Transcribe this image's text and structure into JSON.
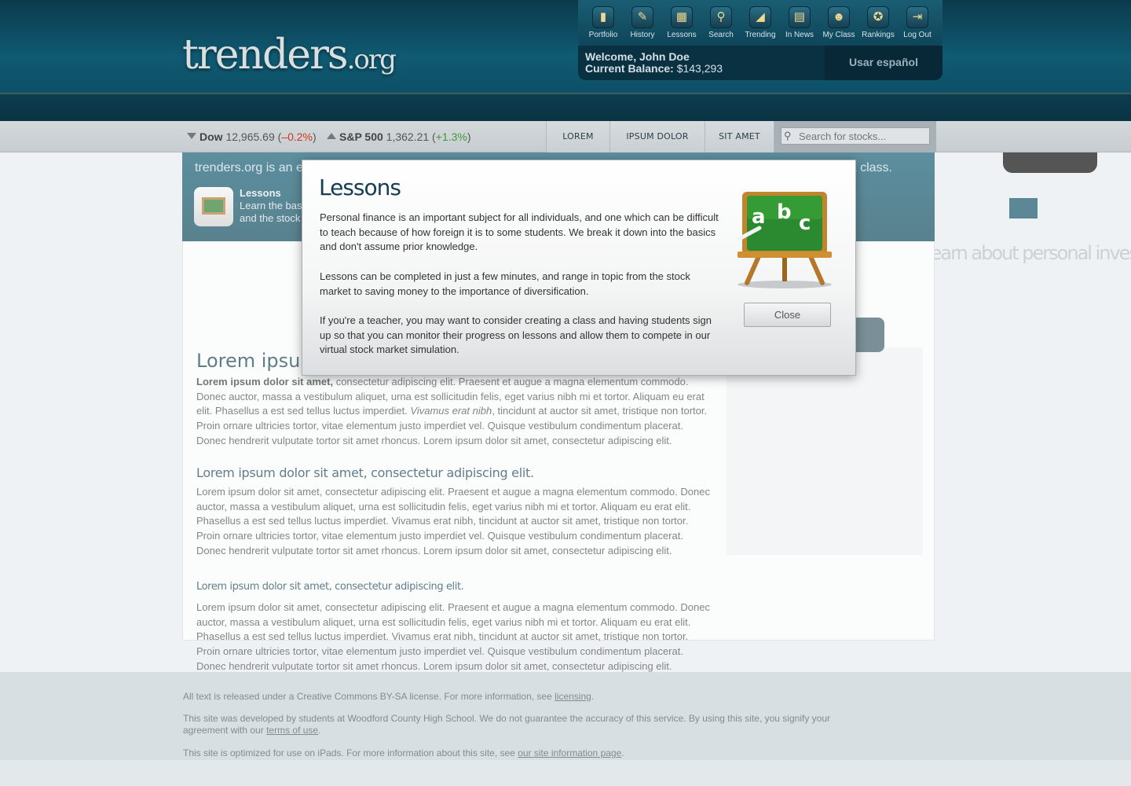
{
  "header": {
    "logo_main": "trenders",
    "logo_suffix": ".org",
    "nav": [
      {
        "label": "Portfolio",
        "icon": "portfolio-icon",
        "glyph": "▮"
      },
      {
        "label": "History",
        "icon": "history-icon",
        "glyph": "✎"
      },
      {
        "label": "Lessons",
        "icon": "lessons-icon",
        "glyph": "▦"
      },
      {
        "label": "Search",
        "icon": "search-icon",
        "glyph": "⚲"
      },
      {
        "label": "Trending",
        "icon": "trending-icon",
        "glyph": "◢"
      },
      {
        "label": "In News",
        "icon": "news-icon",
        "glyph": "▤"
      },
      {
        "label": "My Class",
        "icon": "class-icon",
        "glyph": "☻"
      },
      {
        "label": "Rankings",
        "icon": "rankings-icon",
        "glyph": "✪"
      },
      {
        "label": "Log Out",
        "icon": "logout-icon",
        "glyph": "⇥"
      }
    ],
    "welcome": "Welcome, John Doe",
    "balance_label": "Current Balance:",
    "balance_value": "$143,293",
    "language_button": "Usar español"
  },
  "ticker": {
    "dow": {
      "name": "Dow",
      "value": "12,965.69",
      "change": "–0.2%",
      "direction": "down"
    },
    "sp500": {
      "name": "S&P 500",
      "value": "1,362.21",
      "change": "+1.3%",
      "direction": "up"
    },
    "tabs": [
      "LOREM",
      "IPSUM DOLOR",
      "SIT AMET"
    ],
    "search_placeholder": "Search for stocks..."
  },
  "banner": {
    "text": "trenders.org is an ed",
    "text_tail": "a class.",
    "feature_title": "Lessons",
    "feature_desc": "Learn the basi and the stock"
  },
  "content": {
    "heading1": "Lorem ipsum",
    "para1_bold": "Lorem ipsum dolor sit amet,",
    "para1_a": " consectetur adipiscing elit. Praesent et augue a magna elementum commodo. Donec auctor, massa a vestibulum aliquet, urna est sollicitudin felis, eget varius nibh mi et tortor. Aliquam eu erat elit. Phasellus a est sed tellus luctus imperdiet. ",
    "para1_italic": "Vivamus erat nibh",
    "para1_b": ", tincidunt at auctor sit amet, tristique non tortor. Proin ornare ultricies tortor, vitae elementum justo imperdiet vel. Quisque vestibulum condimentum placerat. Donec hendrerit vulputate tortor sit amet rhoncus. Lorem ipsum dolor sit amet, consectetur adipiscing elit.",
    "heading2": "Lorem ipsum dolor sit amet, consectetur adipiscing elit.",
    "para2": "Lorem ipsum dolor sit amet, consectetur adipiscing elit. Praesent et augue a magna elementum commodo. Donec auctor, massa a vestibulum aliquet, urna est sollicitudin felis, eget varius nibh mi et tortor. Aliquam eu erat elit. Phasellus a est sed tellus luctus imperdiet. Vivamus erat nibh, tincidunt at auctor sit amet, tristique non tortor. Proin ornare ultricies tortor, vitae elementum justo imperdiet vel. Quisque vestibulum condimentum placerat. Donec hendrerit vulputate tortor sit amet rhoncus. Lorem ipsum dolor sit amet, consectetur adipiscing elit.",
    "heading3": "Lorem ipsum dolor sit amet, consectetur adipiscing elit.",
    "para3": "Lorem ipsum dolor sit amet, consectetur adipiscing elit. Praesent et augue a magna elementum commodo. Donec auctor, massa a vestibulum aliquet, urna est sollicitudin felis, eget varius nibh mi et tortor. Aliquam eu erat elit. Phasellus a est sed tellus luctus imperdiet. Vivamus erat nibh, tincidunt at auctor sit amet, tristique non tortor. Proin ornare ultricies tortor, vitae elementum justo imperdiet vel. Quisque vestibulum condimentum placerat. Donec hendrerit vulputate tortor sit amet rhoncus. Lorem ipsum dolor sit amet, consectetur adipiscing elit."
  },
  "side": {
    "tagline": "learn about personal inves"
  },
  "footer": {
    "license_pre": "All text is released under a Creative Commons BY-SA license. For more information, see ",
    "license_link": "licensing",
    "license_post": ".",
    "disclaimer_pre": "This site was developed by students at Woodford County High School. We do not guarantee the accuracy of this service. By using this site, you signify your agreement with our ",
    "disclaimer_link": "terms of use",
    "disclaimer_post": ".",
    "ipad_pre": "This site is optimized for use on iPads. For more information about this site, see ",
    "ipad_link": "our site information page",
    "ipad_post": "."
  },
  "modal": {
    "title": "Lessons",
    "p1": "Personal finance is an important subject for all individuals, and one which can be difficult to teach because of how foreign it is to some students. We break it down into the basics and don't assume prior knowledge.",
    "p2": "Lessons can be completed in just a few minutes, and range in topic from the stock market to saving money to the importance of diversification.",
    "p3": "If you're a teacher, you may want to consider creating a class and having students sign up so that you can monitor their progress on lessons and allow them to compete in our virtual stock market simulation.",
    "board_letters": [
      "a",
      "b",
      "c"
    ],
    "close_label": "Close"
  }
}
